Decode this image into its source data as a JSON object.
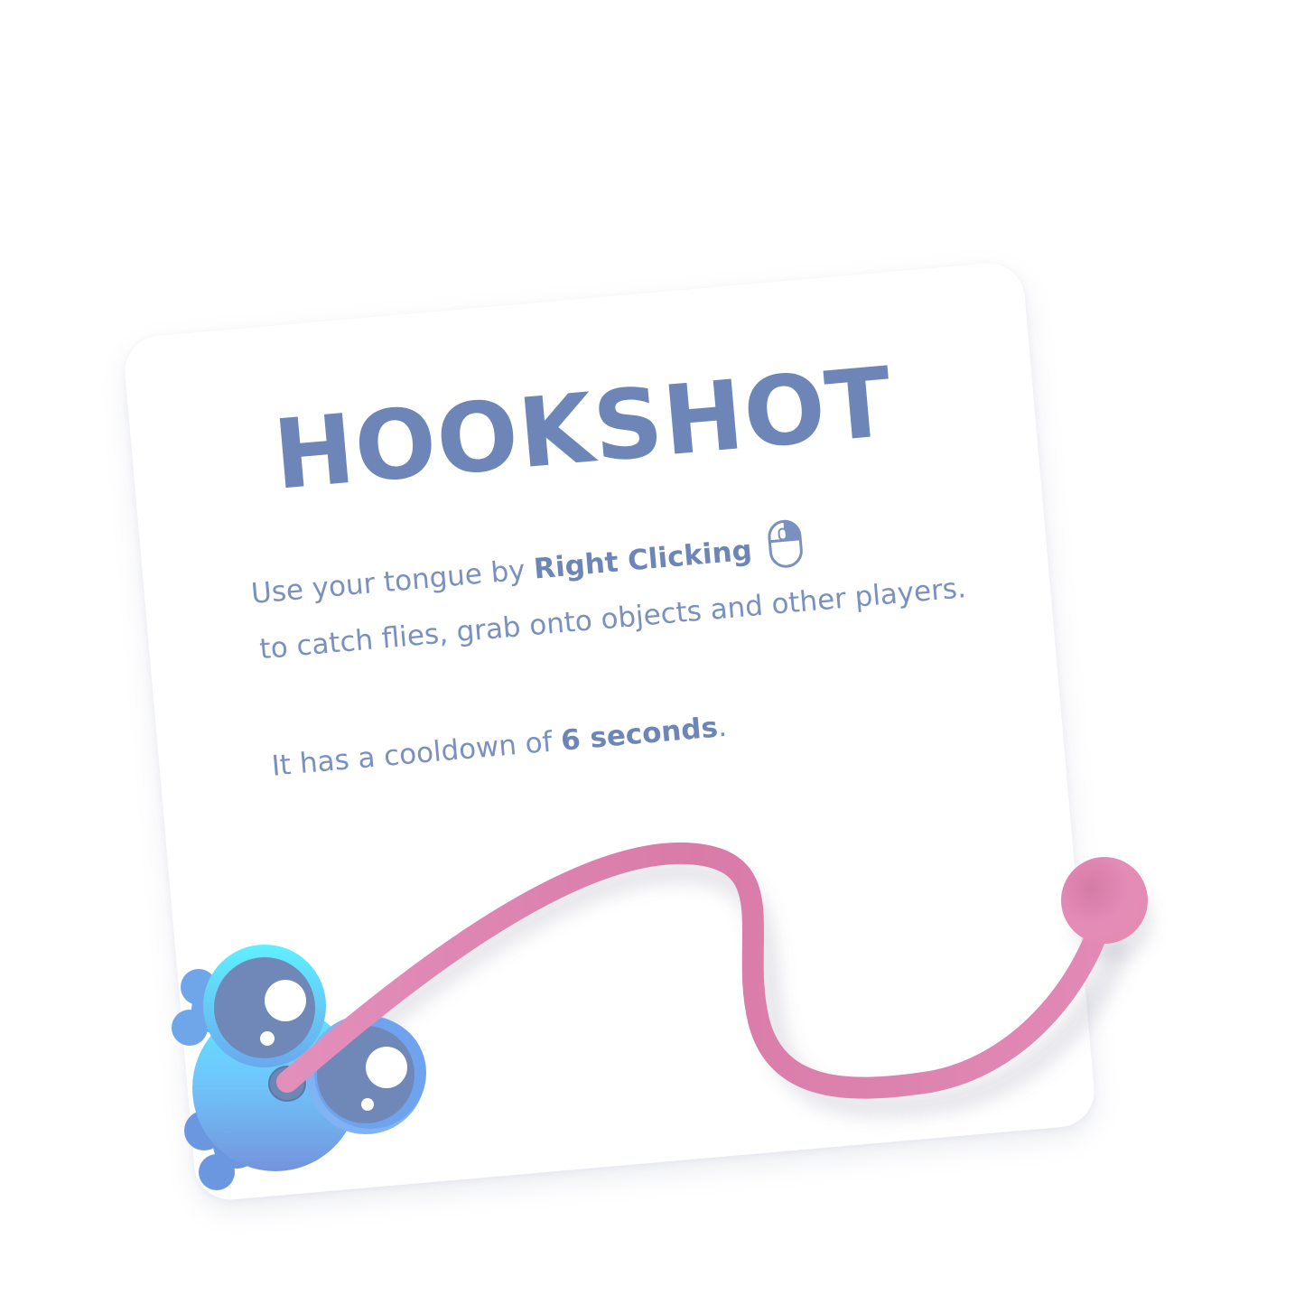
{
  "card": {
    "title": "HOOKSHOT",
    "line1_prefix": "Use your tongue by ",
    "line1_bold": "Right Clicking",
    "line2": "to catch flies, grab onto objects and other players.",
    "cooldown_prefix": "It has a cooldown of ",
    "cooldown_bold": "6 seconds",
    "cooldown_suffix": ".",
    "mouse_icon": "right-mouse-button-icon"
  },
  "illustration": {
    "character": "frog-character",
    "tongue_color": "#e48bb3",
    "body_color": "#76b8f4",
    "eye_color": "#7088b8"
  },
  "colors": {
    "text": "#7a91bf",
    "title": "#6d86b7",
    "card": "#ffffff"
  }
}
